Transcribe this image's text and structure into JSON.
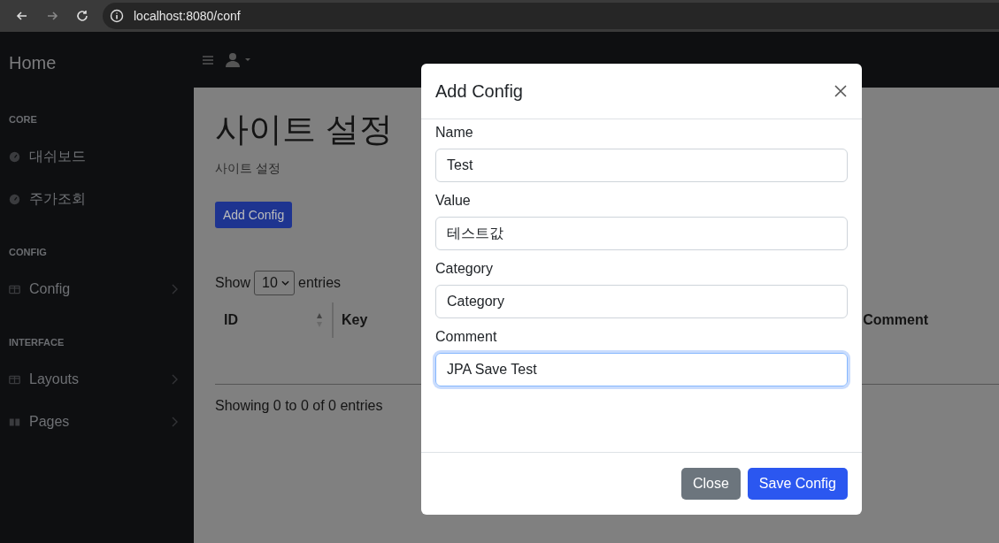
{
  "browser": {
    "url": "localhost:8080/conf"
  },
  "sidebar": {
    "brand": "Home",
    "sections": [
      {
        "heading": "CORE",
        "items": [
          {
            "label": "대쉬보드",
            "kind": "gauge",
            "expandable": false
          },
          {
            "label": "주가조회",
            "kind": "gauge",
            "expandable": false
          }
        ]
      },
      {
        "heading": "CONFIG",
        "items": [
          {
            "label": "Config",
            "kind": "table",
            "expandable": true
          }
        ]
      },
      {
        "heading": "INTERFACE",
        "items": [
          {
            "label": "Layouts",
            "kind": "table",
            "expandable": true
          },
          {
            "label": "Pages",
            "kind": "book",
            "expandable": true
          }
        ]
      }
    ]
  },
  "page": {
    "title": "사이트 설정",
    "subtitle": "사이트 설정",
    "add_button": "Add Config",
    "length": {
      "show": "Show",
      "value": "10",
      "entries": "entries"
    },
    "table": {
      "columns": [
        {
          "label": "ID",
          "sortable": true
        },
        {
          "label": "Key",
          "sortable": false
        },
        {
          "label": "Comment",
          "sortable": false
        }
      ]
    },
    "info": "Showing 0 to 0 of 0 entries"
  },
  "modal": {
    "title": "Add Config",
    "fields": [
      {
        "label": "Name",
        "value": "Test",
        "focused": false
      },
      {
        "label": "Value",
        "value": "테스트값",
        "focused": false
      },
      {
        "label": "Category",
        "value": "Category",
        "focused": false
      },
      {
        "label": "Comment",
        "value": "JPA Save Test",
        "focused": true
      }
    ],
    "buttons": [
      {
        "label": "Close",
        "kind": "secondary"
      },
      {
        "label": "Save Config",
        "kind": "primary"
      }
    ]
  }
}
